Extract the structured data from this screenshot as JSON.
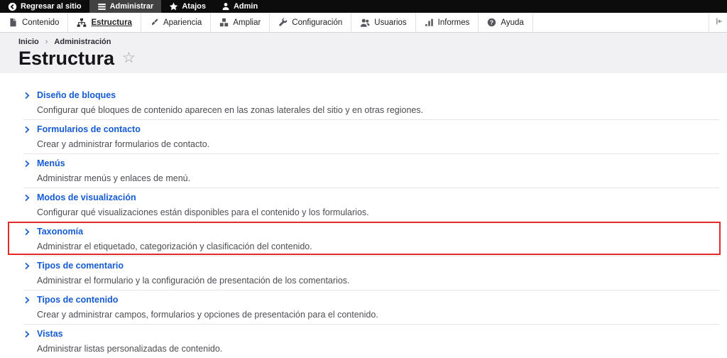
{
  "colors": {
    "accent_blue": "#155bd4",
    "highlight_red": "#e02b2b",
    "admin_bar_bg": "#0c0c0c",
    "header_bg": "#f1f1f4"
  },
  "admin_bar": {
    "items": [
      {
        "label": "Regresar al sitio",
        "icon": "back-icon"
      },
      {
        "label": "Administrar",
        "icon": "menu-icon",
        "active": true
      },
      {
        "label": "Atajos",
        "icon": "star-icon"
      },
      {
        "label": "Admin",
        "icon": "user-icon"
      }
    ]
  },
  "toolbar": {
    "items": [
      {
        "label": "Contenido",
        "icon": "document-icon"
      },
      {
        "label": "Estructura",
        "icon": "sitemap-icon",
        "active": true
      },
      {
        "label": "Apariencia",
        "icon": "paintbrush-icon"
      },
      {
        "label": "Ampliar",
        "icon": "modules-icon"
      },
      {
        "label": "Configuración",
        "icon": "wrench-icon"
      },
      {
        "label": "Usuarios",
        "icon": "users-icon"
      },
      {
        "label": "Informes",
        "icon": "bar-chart-icon"
      },
      {
        "label": "Ayuda",
        "icon": "help-icon"
      }
    ]
  },
  "breadcrumb": {
    "items": [
      "Inicio",
      "Administración"
    ],
    "separator": "›"
  },
  "page": {
    "title": "Estructura",
    "favorite_star": "☆"
  },
  "sections": [
    {
      "title": "Diseño de bloques",
      "description": "Configurar qué bloques de contenido aparecen en las zonas laterales del sitio y en otras regiones.",
      "highlighted": false
    },
    {
      "title": "Formularios de contacto",
      "description": "Crear y administrar formularios de contacto.",
      "highlighted": false
    },
    {
      "title": "Menús",
      "description": "Administrar menús y enlaces de menú.",
      "highlighted": false
    },
    {
      "title": "Modos de visualización",
      "description": "Configurar qué visualizaciones están disponibles para el contenido y los formularios.",
      "highlighted": false
    },
    {
      "title": "Taxonomía",
      "description": "Administrar el etiquetado, categorización y clasificación del contenido.",
      "highlighted": true
    },
    {
      "title": "Tipos de comentario",
      "description": "Administrar el formulario y la configuración de presentación de los comentarios.",
      "highlighted": false
    },
    {
      "title": "Tipos de contenido",
      "description": "Crear y administrar campos, formularios y opciones de presentación para el contenido.",
      "highlighted": false
    },
    {
      "title": "Vistas",
      "description": "Administrar listas personalizadas de contenido.",
      "highlighted": false
    }
  ]
}
